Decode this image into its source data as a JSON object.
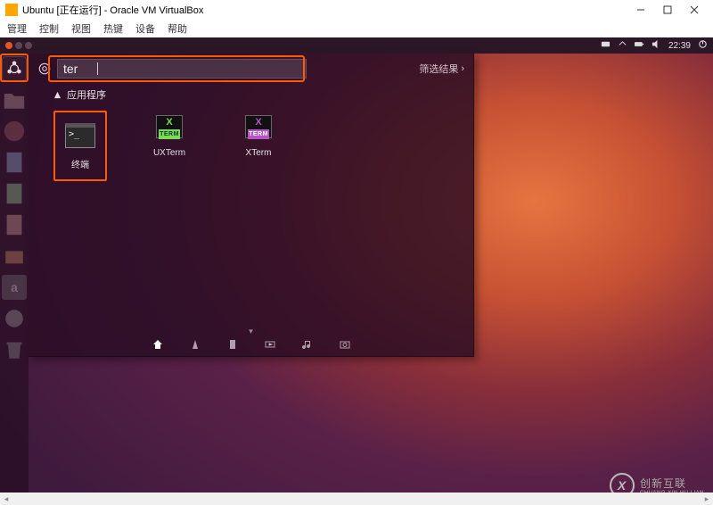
{
  "vbox": {
    "title": "Ubuntu [正在运行] - Oracle VM VirtualBox",
    "menu": [
      "管理",
      "控制",
      "视图",
      "热键",
      "设备",
      "帮助"
    ]
  },
  "ubuntu_panel": {
    "time": "22:39"
  },
  "launcher": {
    "items": [
      {
        "name": "dash",
        "icon": "ubuntu-logo"
      },
      {
        "name": "files",
        "icon": "folder-icon"
      },
      {
        "name": "firefox",
        "icon": "firefox-icon"
      },
      {
        "name": "document",
        "icon": "document-icon"
      },
      {
        "name": "calc",
        "icon": "calc-icon"
      },
      {
        "name": "impress",
        "icon": "impress-icon"
      },
      {
        "name": "software",
        "icon": "software-icon"
      },
      {
        "name": "amazon",
        "icon": "amazon-icon"
      },
      {
        "name": "settings",
        "icon": "settings-icon"
      },
      {
        "name": "trash",
        "icon": "trash-icon"
      }
    ]
  },
  "dash": {
    "search_value": "ter",
    "filter_label": "筛选结果",
    "section_title": "应用程序",
    "results": [
      {
        "label": "终端",
        "icon": "terminal-icon"
      },
      {
        "label": "UXTerm",
        "icon": "uxterm-icon"
      },
      {
        "label": "XTerm",
        "icon": "xterm-icon"
      }
    ],
    "lenses": [
      "home",
      "apps",
      "files",
      "video",
      "music",
      "photos"
    ]
  },
  "watermark": {
    "brand_cn": "创新互联",
    "brand_en": "CHUANG XIN HU LIAN"
  }
}
